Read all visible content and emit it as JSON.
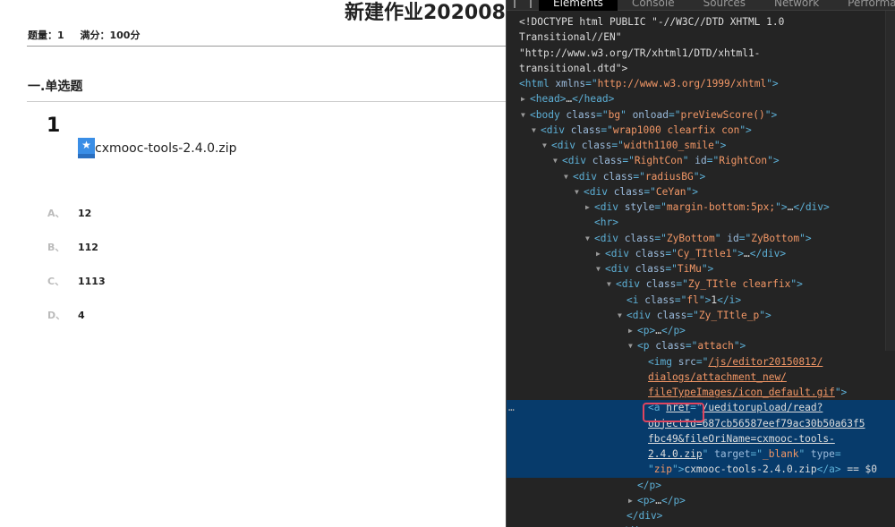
{
  "page": {
    "title": "新建作业202008",
    "count_label": "题量：1",
    "score_label": "满分：100分",
    "section": "一.单选题",
    "question_number": "1",
    "attachment_name": "cxmooc-tools-2.4.0.zip",
    "options": [
      {
        "letter": "A、",
        "text": "12"
      },
      {
        "letter": "B、",
        "text": "112"
      },
      {
        "letter": "C、",
        "text": "1113"
      },
      {
        "letter": "D、",
        "text": "4"
      }
    ]
  },
  "devtools": {
    "tabs": [
      "Elements",
      "Console",
      "Sources",
      "Network",
      "Performance"
    ],
    "selected_tab": "Elements",
    "lines": [
      {
        "i": -1,
        "p": [
          [
            "tx",
            "<!DOCTYPE html PUBLIC \"-//W3C//DTD XHTML 1.0"
          ]
        ]
      },
      {
        "i": -1,
        "p": [
          [
            "tx",
            "Transitional//EN\""
          ]
        ]
      },
      {
        "i": -1,
        "p": [
          [
            "tx",
            "\"http://www.w3.org/TR/xhtml1/DTD/xhtml1-"
          ]
        ]
      },
      {
        "i": -1,
        "p": [
          [
            "tx",
            "transitional.dtd\">"
          ]
        ]
      },
      {
        "i": -1,
        "p": [
          [
            "tag",
            "<html "
          ],
          [
            "an",
            "xmlns"
          ],
          [
            "tag",
            "=\""
          ],
          [
            "av",
            "http://www.w3.org/1999/xhtml"
          ],
          [
            "tag",
            "\">"
          ]
        ]
      },
      {
        "i": 0,
        "a": "r",
        "p": [
          [
            "tag",
            "<head>"
          ],
          [
            "tx",
            "…"
          ],
          [
            "tag",
            "</head>"
          ]
        ]
      },
      {
        "i": 0,
        "a": "d",
        "p": [
          [
            "tag",
            "<body "
          ],
          [
            "an",
            "class"
          ],
          [
            "tag",
            "=\""
          ],
          [
            "av",
            "bg"
          ],
          [
            "tag",
            "\" "
          ],
          [
            "an",
            "onload"
          ],
          [
            "tag",
            "=\""
          ],
          [
            "av",
            "preViewScore()"
          ],
          [
            "tag",
            "\">"
          ]
        ]
      },
      {
        "i": 1,
        "a": "d",
        "p": [
          [
            "tag",
            "<div "
          ],
          [
            "an",
            "class"
          ],
          [
            "tag",
            "=\""
          ],
          [
            "av",
            "wrap1000 clearfix con"
          ],
          [
            "tag",
            "\">"
          ]
        ]
      },
      {
        "i": 2,
        "a": "d",
        "p": [
          [
            "tag",
            "<div "
          ],
          [
            "an",
            "class"
          ],
          [
            "tag",
            "=\""
          ],
          [
            "av",
            "width1100_smile"
          ],
          [
            "tag",
            "\">"
          ]
        ]
      },
      {
        "i": 3,
        "a": "d",
        "p": [
          [
            "tag",
            "<div "
          ],
          [
            "an",
            "class"
          ],
          [
            "tag",
            "=\""
          ],
          [
            "av",
            "RightCon"
          ],
          [
            "tag",
            "\" "
          ],
          [
            "an",
            "id"
          ],
          [
            "tag",
            "=\""
          ],
          [
            "av",
            "RightCon"
          ],
          [
            "tag",
            "\">"
          ]
        ]
      },
      {
        "i": 4,
        "a": "d",
        "p": [
          [
            "tag",
            "<div "
          ],
          [
            "an",
            "class"
          ],
          [
            "tag",
            "=\""
          ],
          [
            "av",
            "radiusBG"
          ],
          [
            "tag",
            "\">"
          ]
        ]
      },
      {
        "i": 5,
        "a": "d",
        "p": [
          [
            "tag",
            "<div "
          ],
          [
            "an",
            "class"
          ],
          [
            "tag",
            "=\""
          ],
          [
            "av",
            "CeYan"
          ],
          [
            "tag",
            "\">"
          ]
        ]
      },
      {
        "i": 6,
        "a": "r",
        "p": [
          [
            "tag",
            "<div "
          ],
          [
            "an",
            "style"
          ],
          [
            "tag",
            "=\""
          ],
          [
            "av",
            "margin-bottom:5px;"
          ],
          [
            "tag",
            "\">"
          ],
          [
            "tx",
            "…"
          ],
          [
            "tag",
            "</div>"
          ]
        ]
      },
      {
        "i": 6,
        "p": [
          [
            "tag",
            "<hr>"
          ]
        ]
      },
      {
        "i": 6,
        "a": "d",
        "p": [
          [
            "tag",
            "<div "
          ],
          [
            "an",
            "class"
          ],
          [
            "tag",
            "=\""
          ],
          [
            "av",
            "ZyBottom"
          ],
          [
            "tag",
            "\" "
          ],
          [
            "an",
            "id"
          ],
          [
            "tag",
            "=\""
          ],
          [
            "av",
            "ZyBottom"
          ],
          [
            "tag",
            "\">"
          ]
        ]
      },
      {
        "i": 7,
        "a": "r",
        "p": [
          [
            "tag",
            "<div "
          ],
          [
            "an",
            "class"
          ],
          [
            "tag",
            "=\""
          ],
          [
            "av",
            "Cy_TItle1"
          ],
          [
            "tag",
            "\">"
          ],
          [
            "tx",
            "…"
          ],
          [
            "tag",
            "</div>"
          ]
        ]
      },
      {
        "i": 7,
        "a": "d",
        "p": [
          [
            "tag",
            "<div "
          ],
          [
            "an",
            "class"
          ],
          [
            "tag",
            "=\""
          ],
          [
            "av",
            "TiMu"
          ],
          [
            "tag",
            "\">"
          ]
        ]
      },
      {
        "i": 8,
        "a": "d",
        "p": [
          [
            "tag",
            "<div "
          ],
          [
            "an",
            "class"
          ],
          [
            "tag",
            "=\""
          ],
          [
            "av",
            "Zy_TItle clearfix"
          ],
          [
            "tag",
            "\">"
          ]
        ]
      },
      {
        "i": 9,
        "p": [
          [
            "tag",
            "<i "
          ],
          [
            "an",
            "class"
          ],
          [
            "tag",
            "=\""
          ],
          [
            "av",
            "fl"
          ],
          [
            "tag",
            "\">"
          ],
          [
            "tx",
            "1"
          ],
          [
            "tag",
            "</i>"
          ]
        ]
      },
      {
        "i": 9,
        "a": "d",
        "p": [
          [
            "tag",
            "<div "
          ],
          [
            "an",
            "class"
          ],
          [
            "tag",
            "=\""
          ],
          [
            "av",
            "Zy_TItle_p"
          ],
          [
            "tag",
            "\">"
          ]
        ]
      },
      {
        "i": 10,
        "a": "r",
        "p": [
          [
            "tag",
            "<p>"
          ],
          [
            "tx",
            "…"
          ],
          [
            "tag",
            "</p>"
          ]
        ]
      },
      {
        "i": 10,
        "a": "d",
        "p": [
          [
            "tag",
            "<p "
          ],
          [
            "an",
            "class"
          ],
          [
            "tag",
            "=\""
          ],
          [
            "av",
            "attach"
          ],
          [
            "tag",
            "\">"
          ]
        ]
      },
      {
        "i": 11,
        "p": [
          [
            "tag",
            "<img "
          ],
          [
            "an",
            "src"
          ],
          [
            "tag",
            "=\""
          ],
          [
            "lk",
            "/js/editor20150812/"
          ]
        ]
      },
      {
        "i": 11,
        "p": [
          [
            "lk",
            "dialogs/attachment_new/"
          ]
        ]
      },
      {
        "i": 11,
        "p": [
          [
            "lk",
            "fileTypeImages/icon_default.gif"
          ],
          [
            "tag",
            "\">"
          ]
        ]
      },
      {
        "i": 11,
        "s": 1,
        "p": [
          [
            "tag",
            "<a "
          ],
          [
            "lkw",
            "href"
          ],
          [
            "tag",
            "=\""
          ],
          [
            "lkw",
            "/ueditorupload/read?"
          ]
        ]
      },
      {
        "i": 11,
        "s": 1,
        "p": [
          [
            "lkw",
            "objectId=687cb56587eef79ac30b50a63f5"
          ]
        ]
      },
      {
        "i": 11,
        "s": 1,
        "p": [
          [
            "lkw",
            "fbc49&fileOriName=cxmooc-tools-"
          ]
        ]
      },
      {
        "i": 11,
        "s": 1,
        "p": [
          [
            "lkw",
            "2.4.0.zip"
          ],
          [
            "tag",
            "\" "
          ],
          [
            "an",
            "target"
          ],
          [
            "tag",
            "=\""
          ],
          [
            "av",
            "_blank"
          ],
          [
            "tag",
            "\" "
          ],
          [
            "an",
            "type"
          ],
          [
            "tag",
            "="
          ]
        ]
      },
      {
        "i": 11,
        "s": 1,
        "p": [
          [
            "tag",
            "\""
          ],
          [
            "av",
            "zip"
          ],
          [
            "tag",
            "\">"
          ],
          [
            "tx",
            "cxmooc-tools-2.4.0.zip"
          ],
          [
            "tag",
            "</a>"
          ],
          [
            "tx",
            " == $0"
          ]
        ]
      },
      {
        "i": 10,
        "p": [
          [
            "tag",
            "</p>"
          ]
        ]
      },
      {
        "i": 10,
        "a": "r",
        "p": [
          [
            "tag",
            "<p>"
          ],
          [
            "tx",
            "…"
          ],
          [
            "tag",
            "</p>"
          ]
        ]
      },
      {
        "i": 9,
        "p": [
          [
            "tag",
            "</div>"
          ]
        ]
      },
      {
        "i": 8,
        "p": [
          [
            "tag",
            "</div>"
          ]
        ]
      }
    ]
  }
}
